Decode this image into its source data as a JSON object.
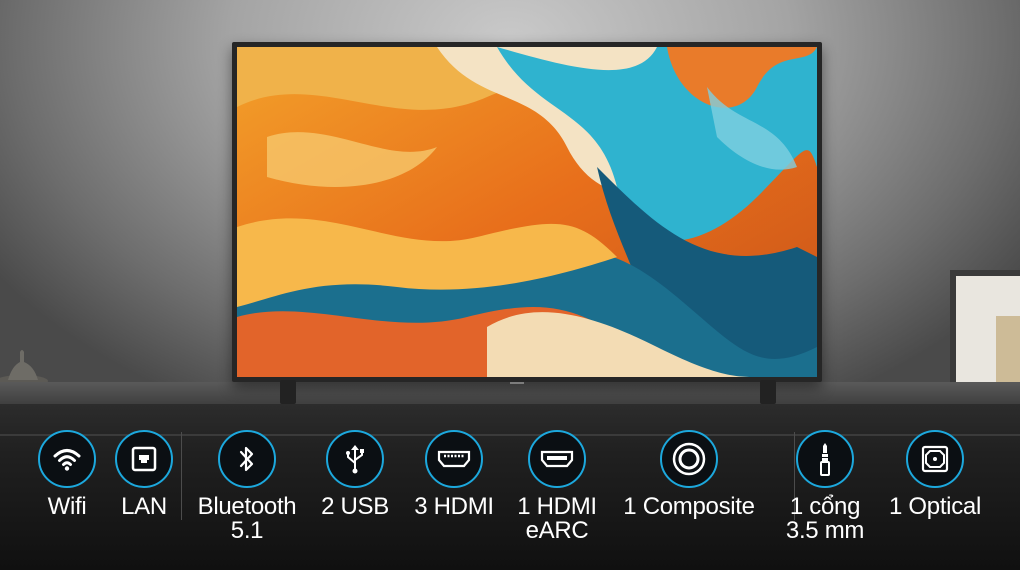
{
  "scene": {
    "subject": "tv-on-cabinet",
    "colors": {
      "wall": "#b5b5b5",
      "cabinet": "#1c1c1c",
      "icon_ring": "#1ca8dd",
      "icon_fill": "#0b0f13",
      "label": "#ffffff"
    }
  },
  "features": [
    {
      "icon": "wifi-icon",
      "line1": "Wifi",
      "line2": ""
    },
    {
      "icon": "lan-port-icon",
      "line1": "LAN",
      "line2": ""
    },
    {
      "icon": "bluetooth-icon",
      "line1": "Bluetooth",
      "line2": "5.1"
    },
    {
      "icon": "usb-icon",
      "line1": "2 USB",
      "line2": ""
    },
    {
      "icon": "hdmi-icon",
      "line1": "3 HDMI",
      "line2": ""
    },
    {
      "icon": "hdmi-earc-icon",
      "line1": "1 HDMI",
      "line2": "eARC"
    },
    {
      "icon": "composite-icon",
      "line1": "1 Composite",
      "line2": ""
    },
    {
      "icon": "audio-jack-icon",
      "line1": "1 cổng",
      "line2": "3.5 mm"
    },
    {
      "icon": "optical-icon",
      "line1": "1 Optical",
      "line2": ""
    }
  ]
}
